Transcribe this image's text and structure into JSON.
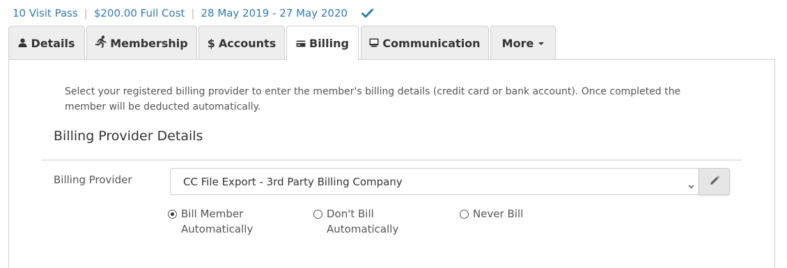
{
  "summary": {
    "pass": "10 Visit Pass",
    "sep": "|",
    "cost": "$200.00 Full Cost",
    "dates": "28 May 2019 - 27 May 2020",
    "check_icon": "check-icon"
  },
  "tabs": [
    {
      "label": "Details",
      "icon": "user-icon",
      "active": false
    },
    {
      "label": "Membership",
      "icon": "running-icon",
      "active": false
    },
    {
      "label": "Accounts",
      "icon": "dollar-icon",
      "active": false
    },
    {
      "label": "Billing",
      "icon": "credit-card-icon",
      "active": true
    },
    {
      "label": "Communication",
      "icon": "monitor-icon",
      "active": false
    },
    {
      "label": "More",
      "icon": "caret-down-icon",
      "active": false
    }
  ],
  "billing": {
    "intro": "Select your registered billing provider to enter the member's billing details (credit card or bank account). Once completed the member will be deducted automatically.",
    "section_title": "Billing Provider Details",
    "provider_label": "Billing Provider",
    "provider_value": "CC File Export - 3rd Party Billing Company",
    "edit_icon": "pencil-icon",
    "radios": [
      {
        "label": "Bill Member Automatically",
        "line1": "Bill Member",
        "line2": "Automatically",
        "selected": true
      },
      {
        "label": "Don't Bill Automatically",
        "line1": "Don't Bill",
        "line2": "Automatically",
        "selected": false
      },
      {
        "label": "Never Bill",
        "line1": "Never Bill",
        "line2": "",
        "selected": false
      }
    ]
  },
  "colors": {
    "link": "#337ab7",
    "tab_bg": "#eeeeee",
    "border": "#d0d0d0"
  }
}
